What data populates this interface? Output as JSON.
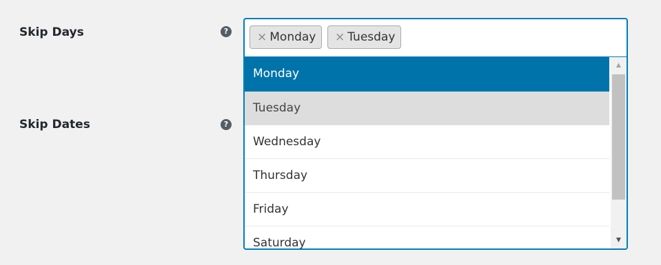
{
  "fields": {
    "skip_days": {
      "label": "Skip Days",
      "help_icon": "question-circle-icon",
      "help_glyph": "?",
      "selected_chips": [
        {
          "remove_glyph": "×",
          "label": "Monday"
        },
        {
          "remove_glyph": "×",
          "label": "Tuesday"
        }
      ],
      "options": [
        "Monday",
        "Tuesday",
        "Wednesday",
        "Thursday",
        "Friday",
        "Saturday"
      ],
      "highlighted_option": "Monday",
      "selected_options": [
        "Monday",
        "Tuesday"
      ]
    },
    "skip_dates": {
      "label": "Skip Dates",
      "help_icon": "question-circle-icon",
      "help_glyph": "?"
    }
  },
  "scrollbar": {
    "up_arrow": "▲",
    "down_arrow": "▼"
  },
  "colors": {
    "accent": "#007cba",
    "highlight": "#0073aa",
    "selected": "#dddddd",
    "background": "#f1f1f1"
  }
}
